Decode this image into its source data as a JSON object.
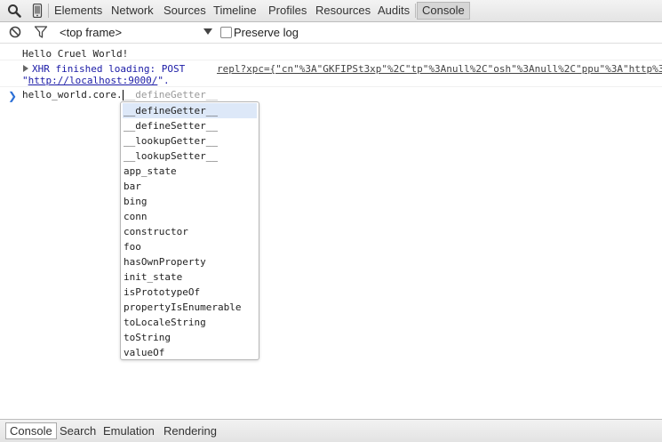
{
  "toolbar": {
    "tabs": [
      {
        "label": "Elements"
      },
      {
        "label": "Network"
      },
      {
        "label": "Sources"
      },
      {
        "label": "Timeline"
      },
      {
        "label": "Profiles"
      },
      {
        "label": "Resources"
      },
      {
        "label": "Audits"
      },
      {
        "label": "Console"
      }
    ],
    "selected_tab": "Console",
    "icons": [
      "search-icon",
      "device-mode-icon"
    ]
  },
  "filterbar": {
    "icons": [
      "clear-console-icon",
      "filter-icon"
    ],
    "frame_select": "<top frame>",
    "preserve_log_label": "Preserve log",
    "preserve_log_checked": false
  },
  "console": {
    "messages": [
      {
        "text": "Hello Cruel World!"
      },
      {
        "xhr_label": "XHR finished loading: POST",
        "url_text": "\"http://localhost:9000/\".",
        "url_link": "http://localhost:9000/",
        "source_link": "repl?xpc={\"cn\"%3A\"GKFIPSt3xp\"%2C\"tp\"%3Anull%2C\"osh\"%3Anull%2C\"ppu\"%3A\"http%3"
      }
    ],
    "prompt": {
      "typed": "hello_world.core.",
      "suggestion": "__defineGetter__"
    }
  },
  "autocomplete": {
    "selected_index": 0,
    "items": [
      "__defineGetter__",
      "__defineSetter__",
      "__lookupGetter__",
      "__lookupSetter__",
      "app_state",
      "bar",
      "bing",
      "conn",
      "constructor",
      "foo",
      "hasOwnProperty",
      "init_state",
      "isPrototypeOf",
      "propertyIsEnumerable",
      "toLocaleString",
      "toString",
      "valueOf"
    ]
  },
  "drawer": {
    "tabs": [
      {
        "label": "Console"
      },
      {
        "label": "Search"
      },
      {
        "label": "Emulation"
      },
      {
        "label": "Rendering"
      }
    ],
    "selected_tab": "Console"
  },
  "colors": {
    "xhr_blue": "#1a1aa6",
    "prompt_blue": "#2b6fd6",
    "selection": "#dde8f8"
  }
}
